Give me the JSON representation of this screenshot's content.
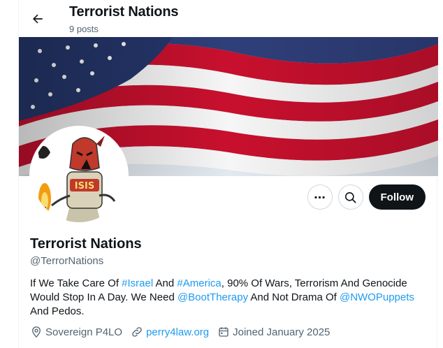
{
  "header": {
    "title": "Terrorist Nations",
    "posts_count": "9 posts"
  },
  "profile": {
    "name": "Terrorist Nations",
    "handle": "@TerrorNations",
    "follow_label": "Follow",
    "bio": {
      "t1": "If We Take Care Of ",
      "l1": "#Israel",
      "t2": " And ",
      "l2": "#America",
      "t3": ", 90% Of Wars, Terrorism And Genocide Would Stop In A Day. We Need ",
      "l3": "@BootTherapy",
      "t4": " And Not Drama Of ",
      "l4": "@NWOPuppets",
      "t5": " And Pedos."
    },
    "location": "Sovereign P4LO",
    "website": "perry4law.org",
    "joined": "Joined January 2025",
    "avatar_text": "ISIS"
  },
  "colors": {
    "accent": "#1d9bf0",
    "text": "#0f1419",
    "muted": "#536471",
    "follow_bg": "#0f1419"
  },
  "icons": {
    "back": "arrow-left-icon",
    "more": "more-horizontal-icon",
    "search": "search-icon",
    "location": "location-pin-icon",
    "link": "link-icon",
    "calendar": "calendar-icon"
  }
}
